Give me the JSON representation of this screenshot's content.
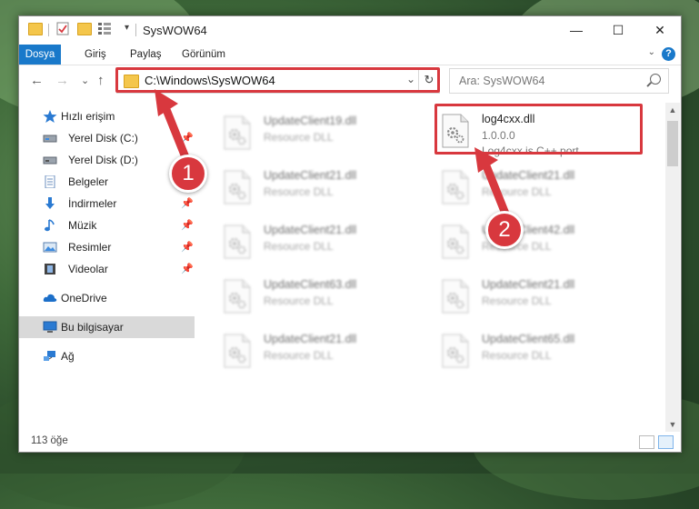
{
  "window": {
    "title": "SysWOW64",
    "controls": {
      "minimize": "—",
      "maximize": "☐",
      "close": "✕"
    }
  },
  "ribbon": {
    "tabs": [
      "Dosya",
      "Giriş",
      "Paylaş",
      "Görünüm"
    ],
    "help": "?",
    "collapse": "⌄"
  },
  "nav": {
    "back": "←",
    "forward": "→",
    "recent": "⌄",
    "up": "↑",
    "address": "C:\\Windows\\SysWOW64",
    "address_dropdown": "⌄",
    "refresh": "↻",
    "search_placeholder": "Ara: SysWOW64"
  },
  "sidebar": {
    "items": [
      {
        "label": "Hızlı erişim",
        "icon": "star-icon",
        "pinned": false
      },
      {
        "label": "Yerel Disk (C:)",
        "icon": "drive-icon",
        "pinned": true
      },
      {
        "label": "Yerel Disk (D:)",
        "icon": "drive-icon",
        "pinned": false
      },
      {
        "label": "Belgeler",
        "icon": "documents-icon",
        "pinned": false
      },
      {
        "label": "İndirmeler",
        "icon": "download-icon",
        "pinned": true
      },
      {
        "label": "Müzik",
        "icon": "music-icon",
        "pinned": true
      },
      {
        "label": "Resimler",
        "icon": "pictures-icon",
        "pinned": true
      },
      {
        "label": "Videolar",
        "icon": "videos-icon",
        "pinned": true
      },
      {
        "label": "OneDrive",
        "icon": "cloud-icon",
        "pinned": false
      },
      {
        "label": "Bu bilgisayar",
        "icon": "computer-icon",
        "pinned": false,
        "selected": true
      },
      {
        "label": "Ağ",
        "icon": "network-icon",
        "pinned": false
      }
    ],
    "pin_glyph": "📌"
  },
  "files": [
    {
      "name": "UpdateClient19.dll",
      "type": "Resource DLL",
      "blurred": true
    },
    {
      "name": "log4cxx.dll",
      "type": "1.0.0.0",
      "desc": "Log4cxx is C++ port...",
      "blurred": false,
      "highlighted": true
    },
    {
      "name": "UpdateClient21.dll",
      "type": "Resource DLL",
      "blurred": true
    },
    {
      "name": "UpdateClient21.dll",
      "type": "Resource DLL",
      "blurred": true
    },
    {
      "name": "UpdateClient21.dll",
      "type": "Resource DLL",
      "blurred": true
    },
    {
      "name": "UpdateClient42.dll",
      "type": "Resource DLL",
      "blurred": true
    },
    {
      "name": "UpdateClient63.dll",
      "type": "Resource DLL",
      "blurred": true
    },
    {
      "name": "UpdateClient21.dll",
      "type": "Resource DLL",
      "blurred": true
    },
    {
      "name": "UpdateClient21.dll",
      "type": "Resource DLL",
      "blurred": true
    },
    {
      "name": "UpdateClient65.dll",
      "type": "Resource DLL",
      "blurred": true
    }
  ],
  "status": {
    "item_count": "113 öğe"
  },
  "annotations": {
    "step1": "1",
    "step2": "2",
    "color": "#d8383e"
  },
  "colors": {
    "accent": "#1979ca",
    "highlight": "#d8383e",
    "folder": "#f4c64b"
  }
}
